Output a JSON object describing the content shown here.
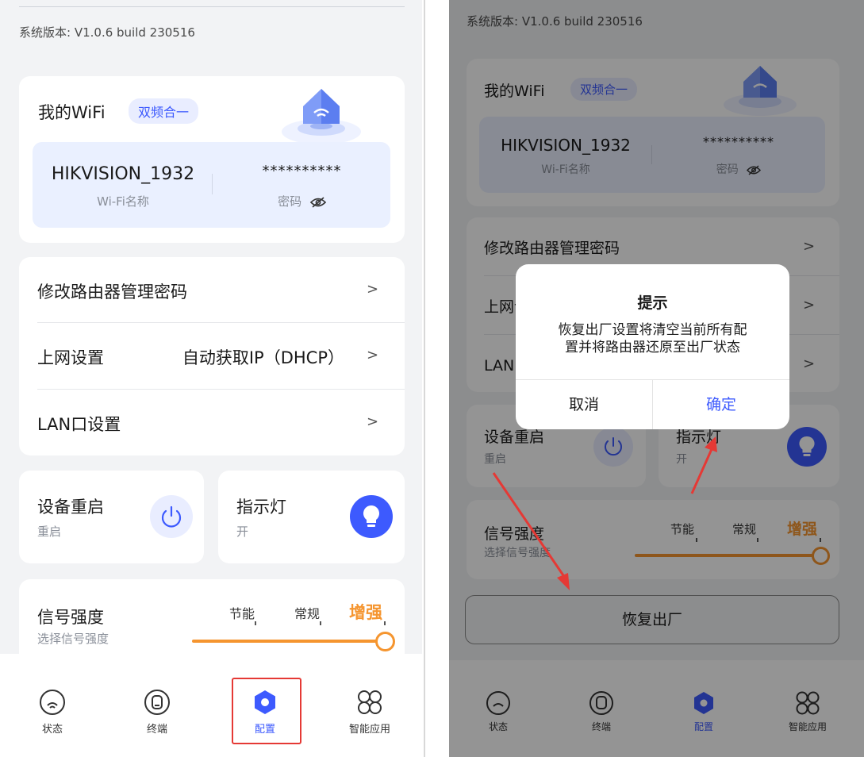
{
  "version_text": "系统版本: V1.0.6 build 230516",
  "wifi": {
    "title": "我的WiFi",
    "badge": "双频合一",
    "ssid": "HIKVISION_1932",
    "ssid_label": "Wi-Fi名称",
    "password": "**********",
    "password_label": "密码"
  },
  "settings": [
    {
      "label": "修改路由器管理密码",
      "value": ""
    },
    {
      "label": "上网设置",
      "value": "自动获取IP（DHCP）"
    },
    {
      "label": "LAN口设置",
      "value": ""
    }
  ],
  "tiles": {
    "reboot": {
      "title": "设备重启",
      "sub": "重启"
    },
    "indicator": {
      "title": "指示灯",
      "sub": "开"
    }
  },
  "signal": {
    "title": "信号强度",
    "sub": "选择信号强度",
    "levels": [
      "节能",
      "常规",
      "增强"
    ],
    "selected": "增强"
  },
  "tabs": [
    {
      "label": "状态",
      "icon": "status-icon"
    },
    {
      "label": "终端",
      "icon": "terminal-icon"
    },
    {
      "label": "配置",
      "icon": "gear-icon"
    },
    {
      "label": "智能应用",
      "icon": "apps-icon"
    }
  ],
  "active_tab": "配置",
  "dialog": {
    "title": "提示",
    "message_line1": "恢复出厂设置将清空当前所有配",
    "message_line2": "置并将路由器还原至出厂状态",
    "cancel": "取消",
    "confirm": "确定"
  },
  "restore_button": "恢复出厂",
  "colors": {
    "accent": "#3d5afe",
    "signal": "#f5952f",
    "annotation": "#e53935"
  }
}
